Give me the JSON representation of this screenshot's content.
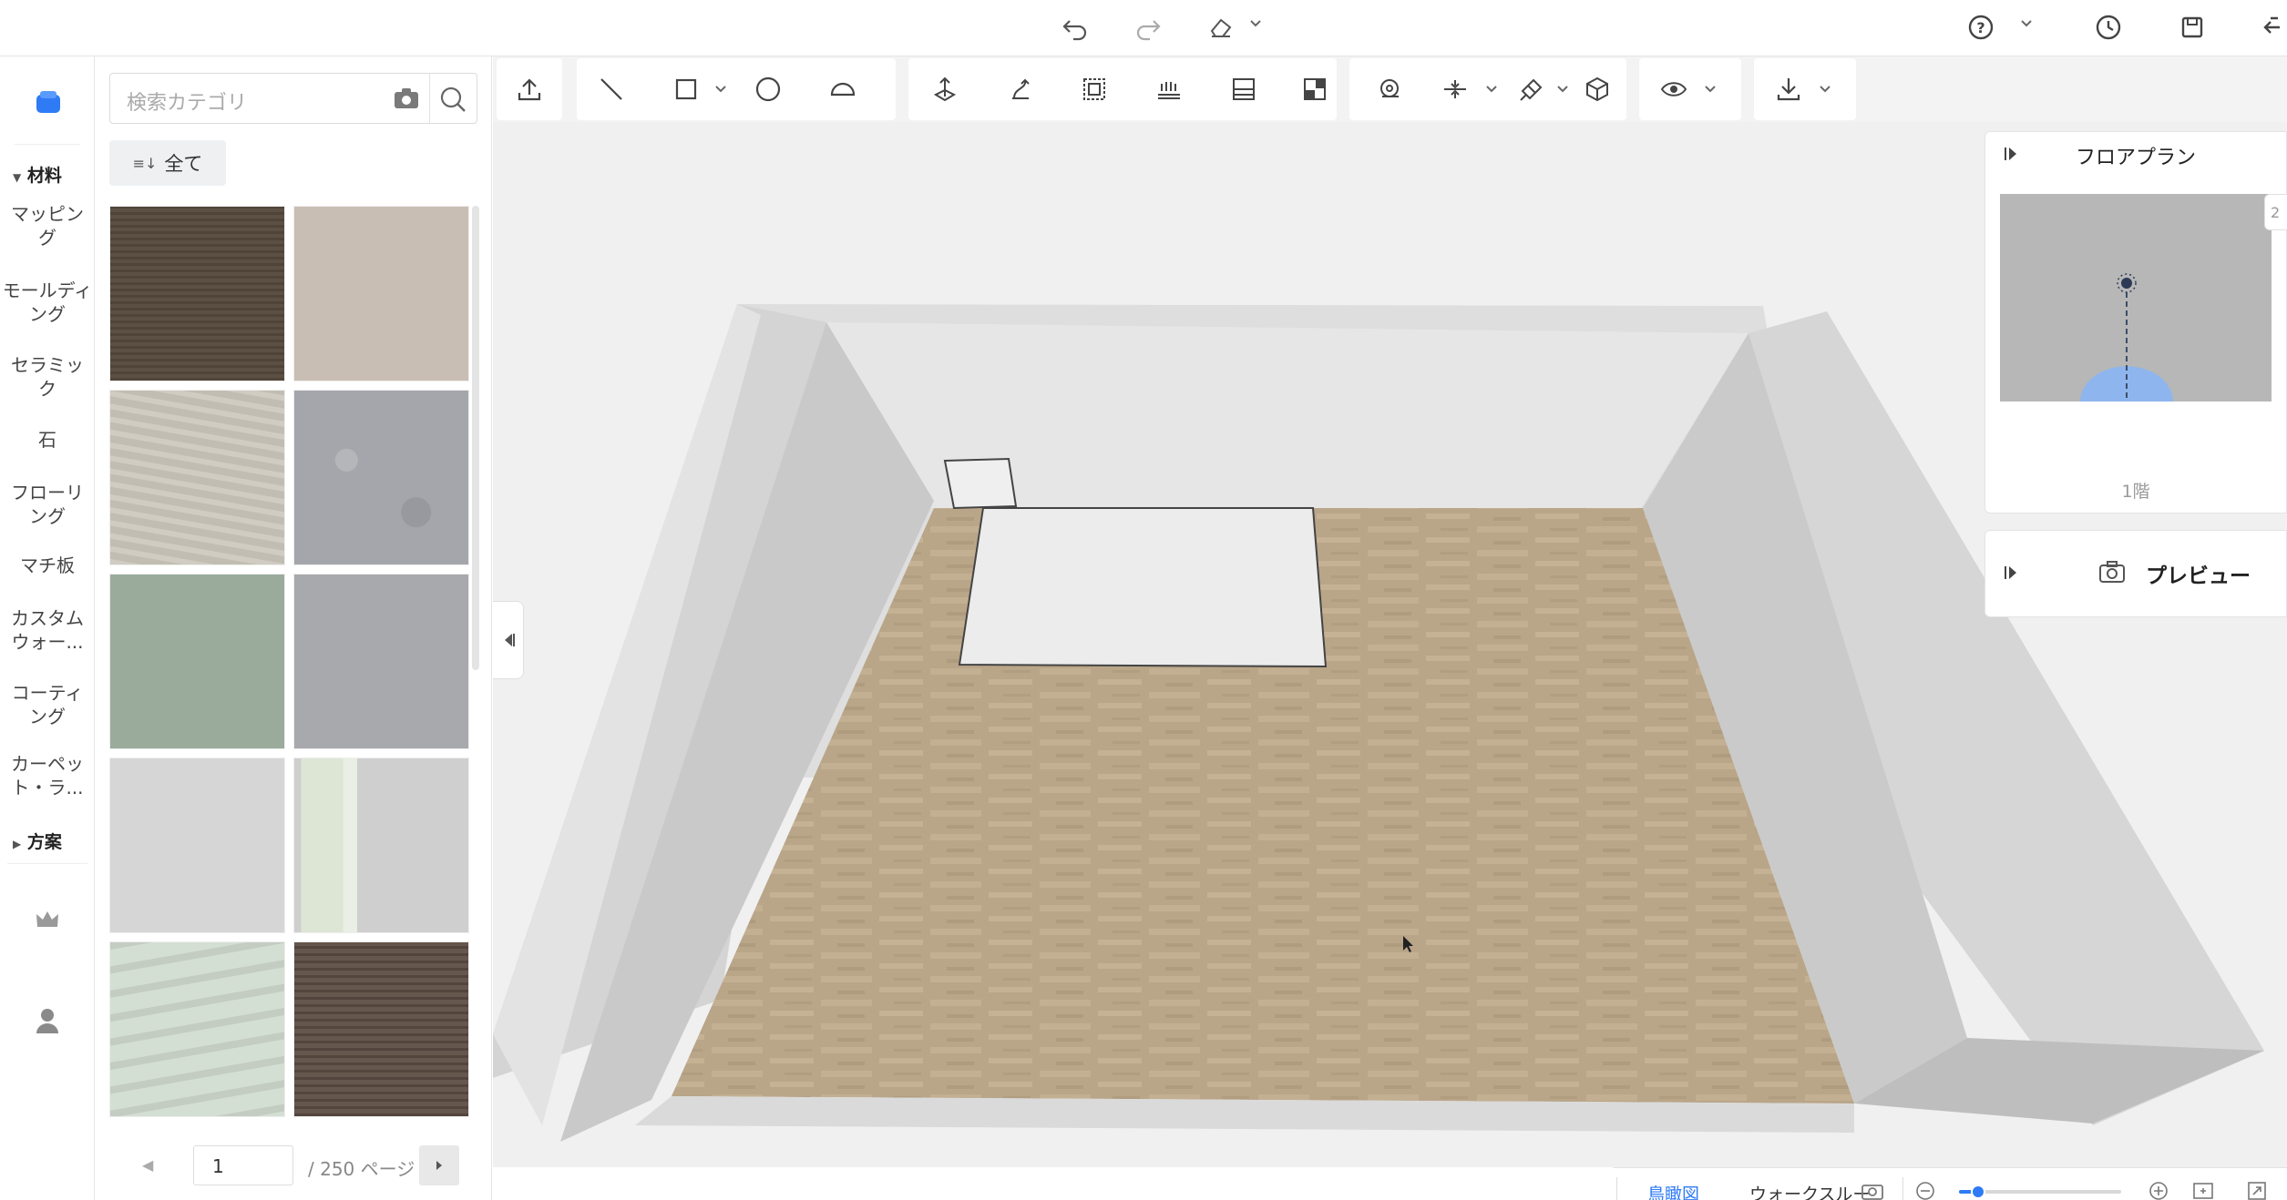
{
  "topbar": {
    "undo_icon": "undo-icon",
    "redo_icon": "redo-icon",
    "eraser_icon": "eraser-icon",
    "help_icon": "help-icon",
    "history_icon": "history-icon",
    "save_icon": "save-icon",
    "exit_icon": "exit-icon"
  },
  "rail": {
    "materials_header": "材料",
    "items": [
      {
        "label": "マッピン\nグ"
      },
      {
        "label": "モールディ\nング"
      },
      {
        "label": "セラミッ\nク"
      },
      {
        "label": "石"
      },
      {
        "label": "フローリ\nング"
      },
      {
        "label": "マチ板"
      },
      {
        "label": "カスタム\nウォー..."
      },
      {
        "label": "コーティ\nング"
      },
      {
        "label": "カーペッ\nト・ラ..."
      }
    ],
    "plans_header": "方案"
  },
  "catalog": {
    "search_placeholder": "検索カテゴリ",
    "all_button": "全て",
    "swatches": [
      {
        "color": "#574a3e",
        "name": "dark-wood"
      },
      {
        "color": "#c9beb3",
        "name": "beige"
      },
      {
        "color": "#c8c3b8",
        "name": "light-stone"
      },
      {
        "color": "#a4a6ab",
        "name": "grey-concrete"
      },
      {
        "color": "#9aab9c",
        "name": "sage-green"
      },
      {
        "color": "#a8a9ad",
        "name": "mid-grey"
      },
      {
        "color": "#d6d6d6",
        "name": "light-grey"
      },
      {
        "color": "#cfcfcf",
        "name": "grey-green-edge"
      },
      {
        "color": "#d4dfd4",
        "name": "pale-green-marble"
      },
      {
        "color": "#5e4e45",
        "name": "dark-walnut"
      }
    ],
    "pager": {
      "current": "1",
      "total": "/ 250 ページ"
    }
  },
  "right": {
    "floorplan_title": "フロアプラン",
    "floor_label": "1階",
    "floorplan_edge_text": "2",
    "preview_title": "プレビュー"
  },
  "bottombar": {
    "birdseye": "鳥瞰図",
    "walkthrough": "ウォークスルー",
    "zoom_level": 0.12
  },
  "colors": {
    "accent": "#2f7bf6",
    "floor": "#b9a588",
    "wall": "#dcdcdc"
  }
}
